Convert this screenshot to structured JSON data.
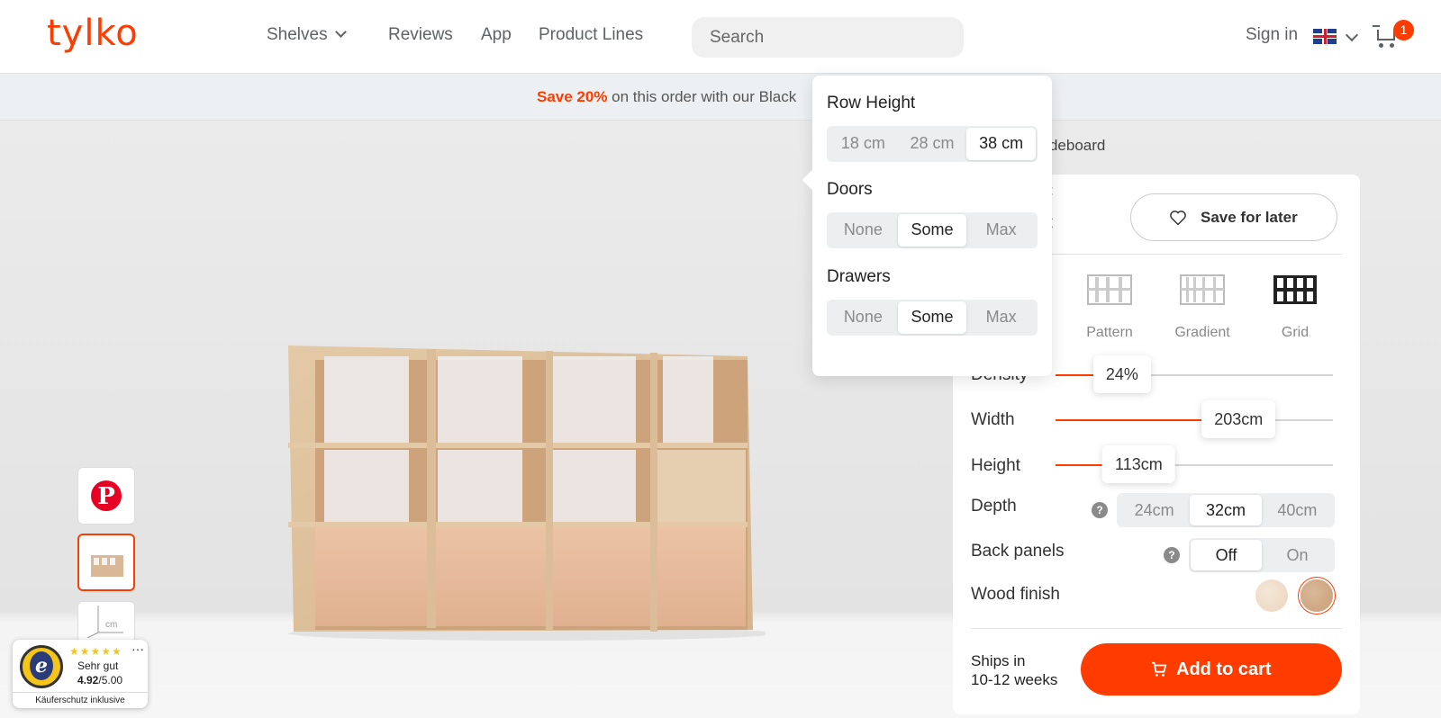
{
  "header": {
    "logo": "tylko",
    "nav": [
      {
        "label": "Shelves"
      },
      {
        "label": "Reviews"
      },
      {
        "label": "App"
      },
      {
        "label": "Product Lines"
      }
    ],
    "search_placeholder": "Search",
    "sign_in": "Sign in",
    "cart_count": "1"
  },
  "promo": {
    "highlight": "Save 20%",
    "text": " on this order with our Black"
  },
  "product": {
    "title": "er Sideboard",
    "price_strike": "€",
    "price_tail": "€",
    "save_for_later": "Save for later"
  },
  "styles": [
    {
      "label": "Pattern"
    },
    {
      "label": "Gradient"
    },
    {
      "label": "Grid"
    }
  ],
  "config": {
    "density": {
      "label": "Density",
      "value": "24%",
      "fraction": 0.24
    },
    "width": {
      "label": "Width",
      "value": "203cm",
      "fraction": 0.66
    },
    "height": {
      "label": "Height",
      "value": "113cm",
      "fraction": 0.3
    },
    "depth": {
      "label": "Depth",
      "options": [
        "24cm",
        "32cm",
        "40cm"
      ],
      "selected": "32cm"
    },
    "back_panels": {
      "label": "Back panels",
      "options": [
        "Off",
        "On"
      ],
      "selected": "Off"
    },
    "wood_finish": {
      "label": "Wood finish"
    }
  },
  "popover": {
    "row_height": {
      "label": "Row Height",
      "options": [
        "18 cm",
        "28 cm",
        "38 cm"
      ],
      "selected": "38 cm"
    },
    "doors": {
      "label": "Doors",
      "options": [
        "None",
        "Some",
        "Max"
      ],
      "selected": "Some"
    },
    "drawers": {
      "label": "Drawers",
      "options": [
        "None",
        "Some",
        "Max"
      ],
      "selected": "Some"
    }
  },
  "shipping": {
    "line1": "Ships in",
    "line2": "10-12 weeks"
  },
  "add_to_cart": "Add to cart",
  "trust": {
    "rating_text": "Sehr gut",
    "score": "4.92",
    "score_max": "/5.00",
    "footer": "Käuferschutz inklusive"
  },
  "colors": {
    "accent": "#ff3c00",
    "panel_bg": "#ffffff",
    "scene_bg": "#e8e8e8"
  }
}
